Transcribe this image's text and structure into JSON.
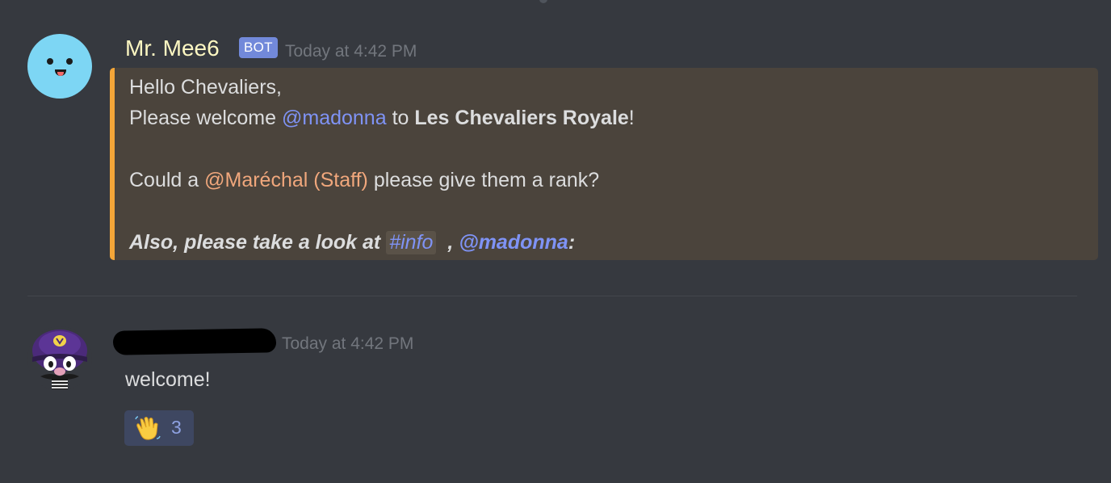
{
  "message1": {
    "username": "Mr. Mee6",
    "bot_tag": "BOT",
    "timestamp": "Today at 4:42 PM",
    "embed": {
      "line1": "Hello Chevaliers,",
      "line2_prefix": "Please welcome ",
      "line2_mention": "@madonna",
      "line2_middle": " to ",
      "line2_server": "Les Chevaliers Royale",
      "line2_suffix": "!",
      "line3_prefix": "Could a ",
      "line3_role": "@Maréchal (Staff)",
      "line3_suffix": " please give them a rank?",
      "line4_prefix": "Also, please take a look at ",
      "line4_channel": "#info",
      "line4_sep": ", ",
      "line4_mention": "@madonna",
      "line4_suffix": ":",
      "accent_color": "#f4a638"
    }
  },
  "message2": {
    "timestamp": "Today at 4:42 PM",
    "text": "welcome!",
    "reaction": {
      "emoji": "waving-hand-icon",
      "count": "3"
    }
  },
  "colors": {
    "background": "#36393f",
    "mention": "#7f93f5",
    "role_mention": "#f0a77c",
    "bot_tag": "#7289da",
    "username": "#fcf7c2"
  }
}
